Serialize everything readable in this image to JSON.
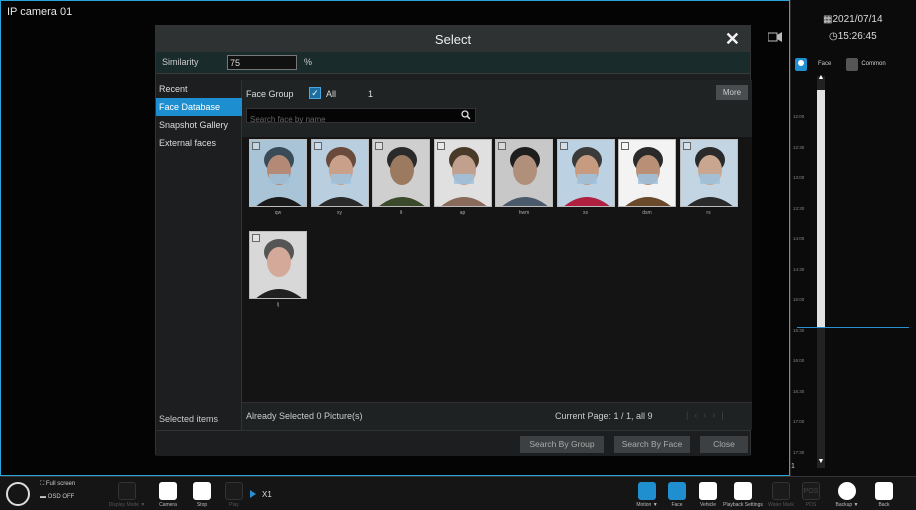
{
  "camera": {
    "title": "IP camera 01"
  },
  "right_panel": {
    "date": "2021/07/14",
    "time": "15:26:45",
    "tabs": [
      {
        "label": "Face",
        "icon": "face-tab-icon"
      },
      {
        "label": "Common",
        "icon": "common-tab-icon"
      }
    ],
    "timeline_ticks": [
      "12:00",
      "12:30",
      "13:00",
      "13:30",
      "14:00",
      "14:30",
      "15:00",
      "15:30",
      "16:00",
      "16:30",
      "17:00",
      "17:30"
    ],
    "timeline_number": "1"
  },
  "dialog": {
    "title": "Select",
    "similarity_label": "Similarity",
    "similarity_value": "75",
    "similarity_unit": "%",
    "sidebar": {
      "items": [
        "Recent",
        "Face Database",
        "Snapshot Gallery",
        "External faces"
      ],
      "active": "Face Database",
      "selected_items_label": "Selected items"
    },
    "face_group_label": "Face Group",
    "all_label": "All",
    "all_checked": true,
    "count": "1",
    "more_label": "More",
    "search_placeholder": "Search face by name",
    "faces": [
      "qw",
      "xy",
      "lt",
      "ap",
      "hwm",
      "xs",
      "dsm",
      "rs",
      "lj"
    ],
    "already_selected": "Already Selected 0 Picture(s)",
    "current_page": "Current Page: 1 / 1, all 9",
    "buttons": {
      "search_by_group": "Search By Group",
      "search_by_face": "Search By Face",
      "close": "Close"
    }
  },
  "toolbar": {
    "fullscreen_label": "Full screen",
    "osd_label": "OSD OFF",
    "display_mode": "Display Mode ▼",
    "camera": "Camera",
    "stop": "Stop",
    "play": "Play",
    "speed": "X1",
    "motion": "Motion ▼",
    "face": "Face",
    "vehicle": "Vehicle",
    "playback_settings": "Playback Settings",
    "watermark": "Water Mark",
    "pos": "POS",
    "pos_icon": "POS",
    "backup": "Backup ▼",
    "back": "Back"
  },
  "colors": {
    "accent": "#1f8fd0",
    "dialog_bg": "#1c1e1f",
    "border": "#2aa4d8"
  }
}
